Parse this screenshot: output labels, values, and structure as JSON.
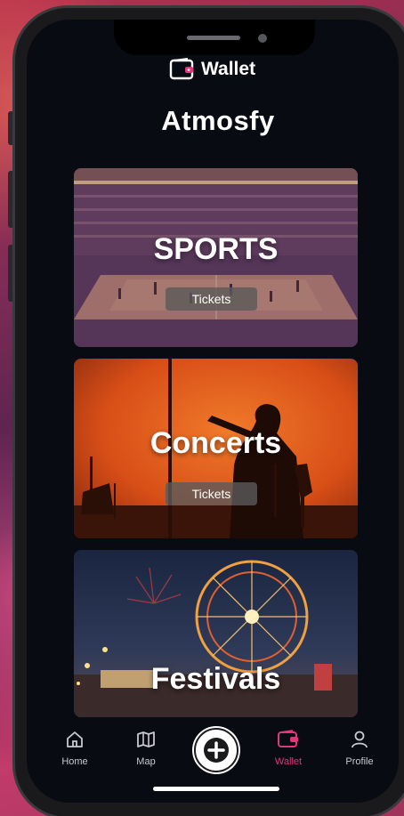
{
  "header": {
    "icon": "wallet-icon",
    "label": "Wallet"
  },
  "app_title": "Atmosfy",
  "categories": [
    {
      "title": "SPORTS",
      "button_label": "Tickets",
      "image": "basketball-arena-photo"
    },
    {
      "title": "Concerts",
      "button_label": "Tickets",
      "image": "singer-silhouette-photo"
    },
    {
      "title": "Festivals",
      "image": "ferris-wheel-fireworks-photo"
    }
  ],
  "tabbar": {
    "items": [
      {
        "label": "Home",
        "icon": "home-icon"
      },
      {
        "label": "Map",
        "icon": "map-icon"
      },
      {
        "label": "",
        "icon": "plus-icon"
      },
      {
        "label": "Wallet",
        "icon": "wallet-icon",
        "active": true
      },
      {
        "label": "Profile",
        "icon": "profile-icon"
      }
    ]
  },
  "colors": {
    "accent": "#e0367a",
    "screen_bg": "#080b12",
    "text": "#ffffff"
  }
}
